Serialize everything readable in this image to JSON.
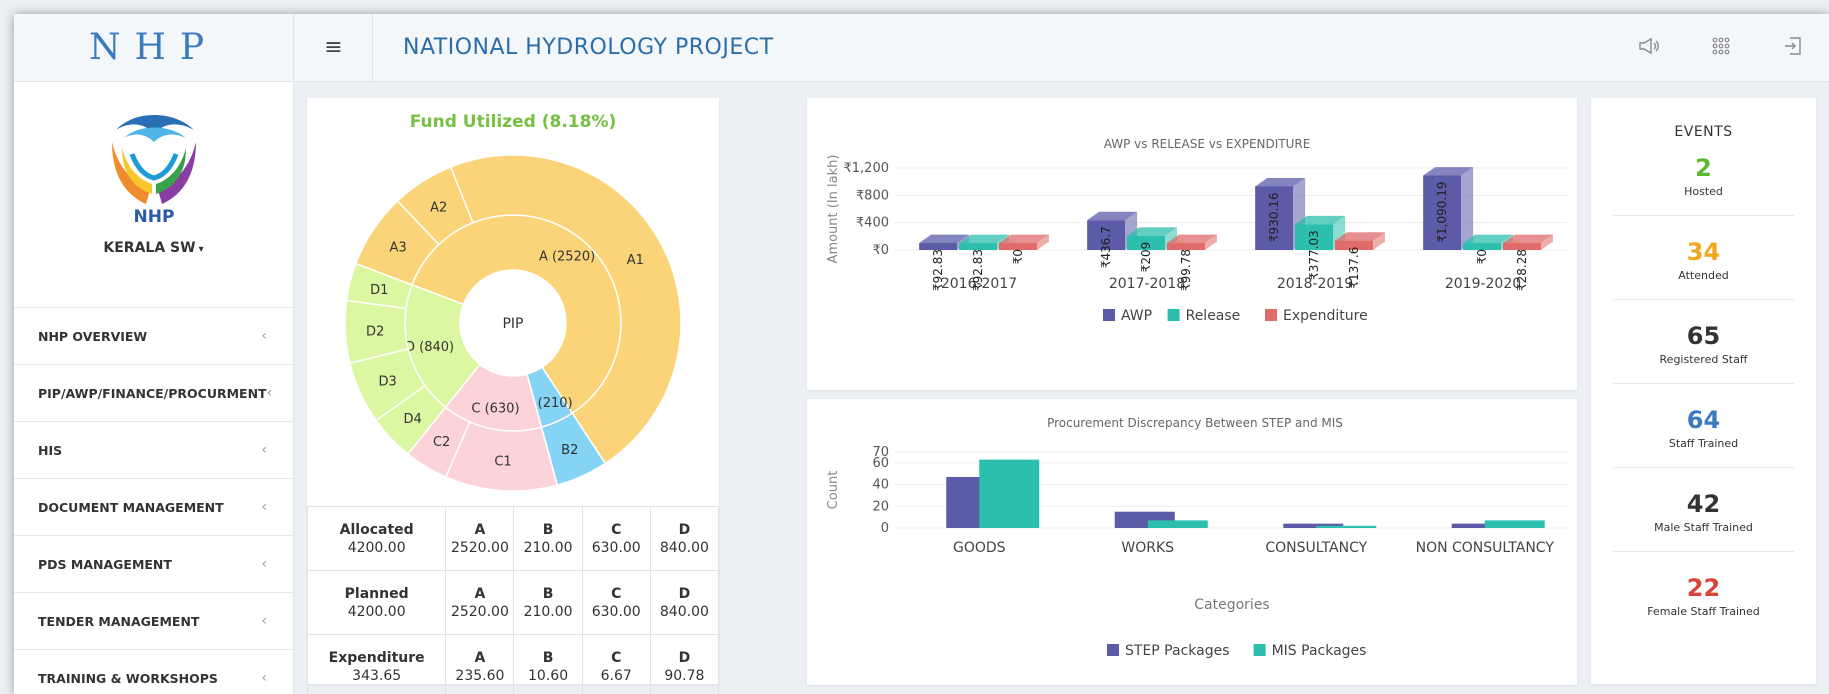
{
  "brand": {
    "logo_text": "NHP"
  },
  "logo": {
    "text": "NHP"
  },
  "sidebar": {
    "org": "KERALA SW",
    "items": [
      {
        "label": "NHP OVERVIEW"
      },
      {
        "label": "PIP/AWP/FINANCE/PROCURMENT"
      },
      {
        "label": "HIS"
      },
      {
        "label": "DOCUMENT MANAGEMENT"
      },
      {
        "label": "PDS MANAGEMENT"
      },
      {
        "label": "TENDER MANAGEMENT"
      },
      {
        "label": "TRAINING & WORKSHOPS"
      }
    ]
  },
  "header": {
    "title": "NATIONAL HYDROLOGY PROJECT",
    "icons": [
      "megaphone-icon",
      "apps-grid-icon",
      "logout-icon"
    ]
  },
  "fund": {
    "title": "Fund Utilized (8.18%)",
    "center_label": "PIP",
    "inner_labels": {
      "A": "A (2520)",
      "B": "B (210)",
      "C": "C (630)",
      "D": "D (840)"
    },
    "outer_labels": [
      "A1",
      "A2",
      "A3",
      "B2",
      "C1",
      "C2",
      "D1",
      "D2",
      "D3",
      "D4"
    ],
    "colors": {
      "A": "#fbd47a",
      "B": "#85d3f5",
      "C": "#fcd3d9",
      "D": "#dcf7a1"
    },
    "table": [
      [
        {
          "label": "Allocated",
          "value": "4200.00"
        },
        {
          "label": "A",
          "value": "2520.00"
        },
        {
          "label": "B",
          "value": "210.00"
        },
        {
          "label": "C",
          "value": "630.00"
        },
        {
          "label": "D",
          "value": "840.00"
        }
      ],
      [
        {
          "label": "Planned",
          "value": "4200.00"
        },
        {
          "label": "A",
          "value": "2520.00"
        },
        {
          "label": "B",
          "value": "210.00"
        },
        {
          "label": "C",
          "value": "630.00"
        },
        {
          "label": "D",
          "value": "840.00"
        }
      ],
      [
        {
          "label": "Expenditure",
          "value": "343.65"
        },
        {
          "label": "A",
          "value": "235.60"
        },
        {
          "label": "B",
          "value": "10.60"
        },
        {
          "label": "C",
          "value": "6.67"
        },
        {
          "label": "D",
          "value": "90.78"
        }
      ]
    ]
  },
  "chart_data": [
    {
      "type": "pie",
      "title": "Fund Utilized (8.18%)",
      "center": "PIP",
      "categories": [
        "A (2520)",
        "B (210)",
        "C (630)",
        "D (840)"
      ],
      "values": [
        2520,
        210,
        630,
        840
      ]
    },
    {
      "type": "bar",
      "title": "AWP vs RELEASE vs EXPENDITURE",
      "ylabel": "Amount (In lakh)",
      "xlabel": "",
      "categories": [
        "2016-2017",
        "2017-2018",
        "2018-2019",
        "2019-2020"
      ],
      "ytick_labels": [
        "₹0",
        "₹400",
        "₹800",
        "₹1,200"
      ],
      "ylim": [
        0,
        1200
      ],
      "series": [
        {
          "name": "AWP",
          "values": [
            92.83,
            436.7,
            930.16,
            1090.19
          ],
          "labels": [
            "₹92.83",
            "₹436.7",
            "₹930.16",
            "₹1,090.19"
          ],
          "color": "#5b5ba8"
        },
        {
          "name": "Release",
          "values": [
            92.83,
            209,
            377.03,
            0
          ],
          "labels": [
            "₹92.83",
            "₹209",
            "₹377.03",
            "₹0"
          ],
          "color": "#2dbfad"
        },
        {
          "name": "Expenditure",
          "values": [
            0,
            99.78,
            137.6,
            28.28
          ],
          "labels": [
            "₹0",
            "₹99.78",
            "₹137.6",
            "₹28.28"
          ],
          "color": "#e06b6b"
        }
      ],
      "legend": "bottom"
    },
    {
      "type": "bar",
      "title": "Procurement Discrepancy Between STEP and MIS",
      "xlabel": "Categories",
      "ylabel": "Count",
      "categories": [
        "GOODS",
        "WORKS",
        "CONSULTANCY",
        "NON CONSULTANCY"
      ],
      "ytick_labels": [
        "0",
        "20",
        "40",
        "60",
        "70"
      ],
      "ylim": [
        0,
        70
      ],
      "series": [
        {
          "name": "STEP Packages",
          "values": [
            47,
            15,
            4,
            4
          ],
          "color": "#5b5ba8"
        },
        {
          "name": "MIS Packages",
          "values": [
            63,
            7,
            2,
            7
          ],
          "color": "#2dbfad"
        }
      ],
      "legend": "bottom"
    }
  ],
  "events": {
    "title": "EVENTS",
    "items": [
      {
        "value": "2",
        "label": "Hosted",
        "color": "#5cb82e"
      },
      {
        "value": "34",
        "label": "Attended",
        "color": "#f2a51d"
      },
      {
        "value": "65",
        "label": "Registered Staff",
        "color": "#333333"
      },
      {
        "value": "64",
        "label": "Staff Trained",
        "color": "#3a7bbf"
      },
      {
        "value": "42",
        "label": "Male Staff Trained",
        "color": "#333333"
      },
      {
        "value": "22",
        "label": "Female Staff Trained",
        "color": "#d9433b"
      }
    ]
  }
}
